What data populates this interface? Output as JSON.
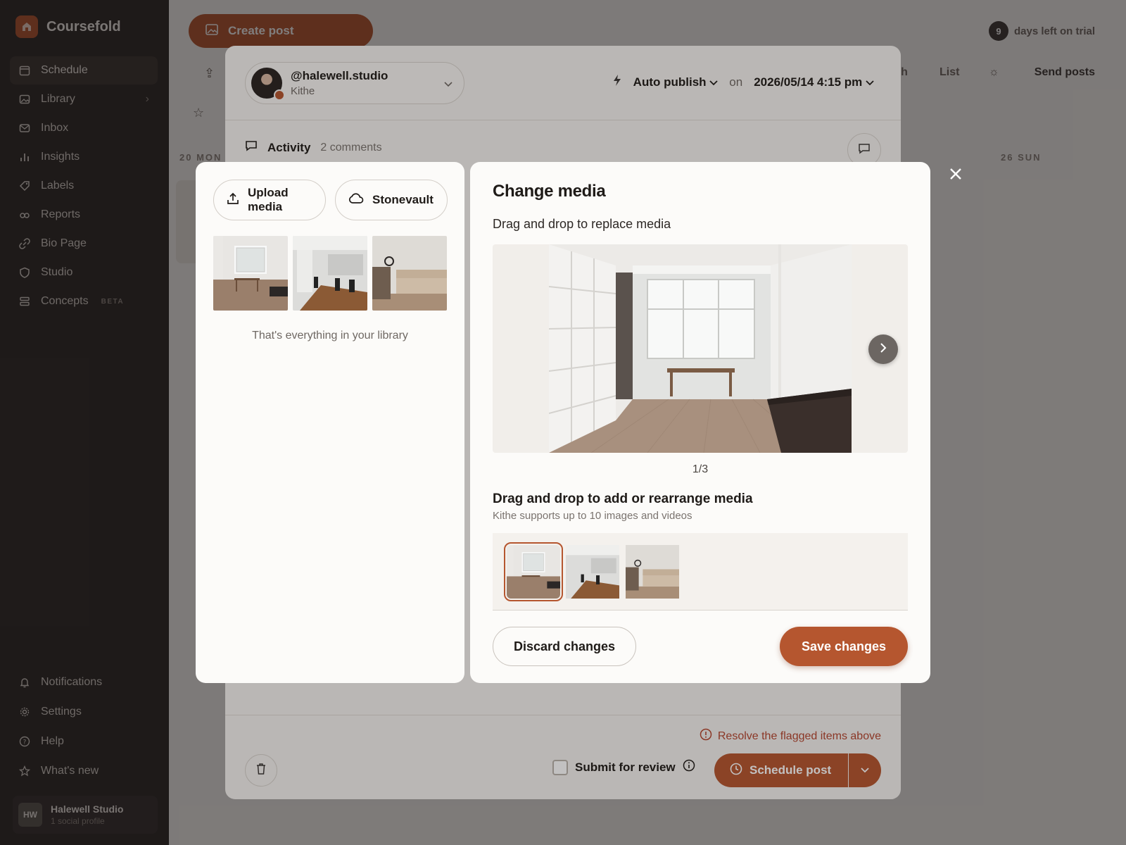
{
  "app": {
    "name": "Coursefold"
  },
  "sidebar": {
    "items": [
      {
        "label": "Schedule",
        "icon": "calendar-icon"
      },
      {
        "label": "Library",
        "icon": "image-icon"
      },
      {
        "label": "Inbox",
        "icon": "mail-icon"
      },
      {
        "label": "Insights",
        "icon": "bar-chart-icon"
      },
      {
        "label": "Labels",
        "icon": "tag-icon"
      },
      {
        "label": "Reports",
        "icon": "reports-icon"
      },
      {
        "label": "Bio Page",
        "icon": "link-icon"
      },
      {
        "label": "Studio",
        "icon": "shield-icon"
      },
      {
        "label": "Concepts",
        "icon": "stack-icon",
        "badge": "BETA"
      }
    ],
    "bottom_items": [
      {
        "label": "Notifications",
        "icon": "bell-icon"
      },
      {
        "label": "Settings",
        "icon": "gear-icon"
      },
      {
        "label": "Help",
        "icon": "help-icon"
      },
      {
        "label": "What's new",
        "icon": "star-icon"
      }
    ],
    "profile": {
      "initials": "HW",
      "name": "Halewell Studio",
      "sub": "1 social profile"
    }
  },
  "header": {
    "create_post": "Create post",
    "trial_days": "9",
    "trial_text": "days left on trial",
    "tab_month": "nth",
    "tab_list": "List",
    "send_posts": "Send posts",
    "day_left": "20 MON",
    "day_right": "26 SUN"
  },
  "editor": {
    "handle": "@halewell.studio",
    "account_name": "Kithe",
    "publish_mode": "Auto publish",
    "on": "on",
    "datetime": "2026/05/14 4:15 pm",
    "activity_title": "Activity",
    "activity_count": "2 comments",
    "flag_message": "Resolve the flagged items above",
    "submit_review": "Submit for review",
    "schedule_post": "Schedule post"
  },
  "library": {
    "upload_label": "Upload media",
    "stonevault_label": "Stonevault",
    "empty_text": "That's everything in your library"
  },
  "dialog": {
    "title": "Change media",
    "subtitle": "Drag and drop to replace media",
    "counter": "1/3",
    "reorder_title": "Drag and drop to add or rearrange media",
    "reorder_sub": "Kithe supports up to 10 images and videos",
    "discard": "Discard changes",
    "save": "Save changes"
  },
  "colors": {
    "accent": "#b5562f",
    "sidebar": "#2b2726",
    "danger": "#b5452f"
  }
}
